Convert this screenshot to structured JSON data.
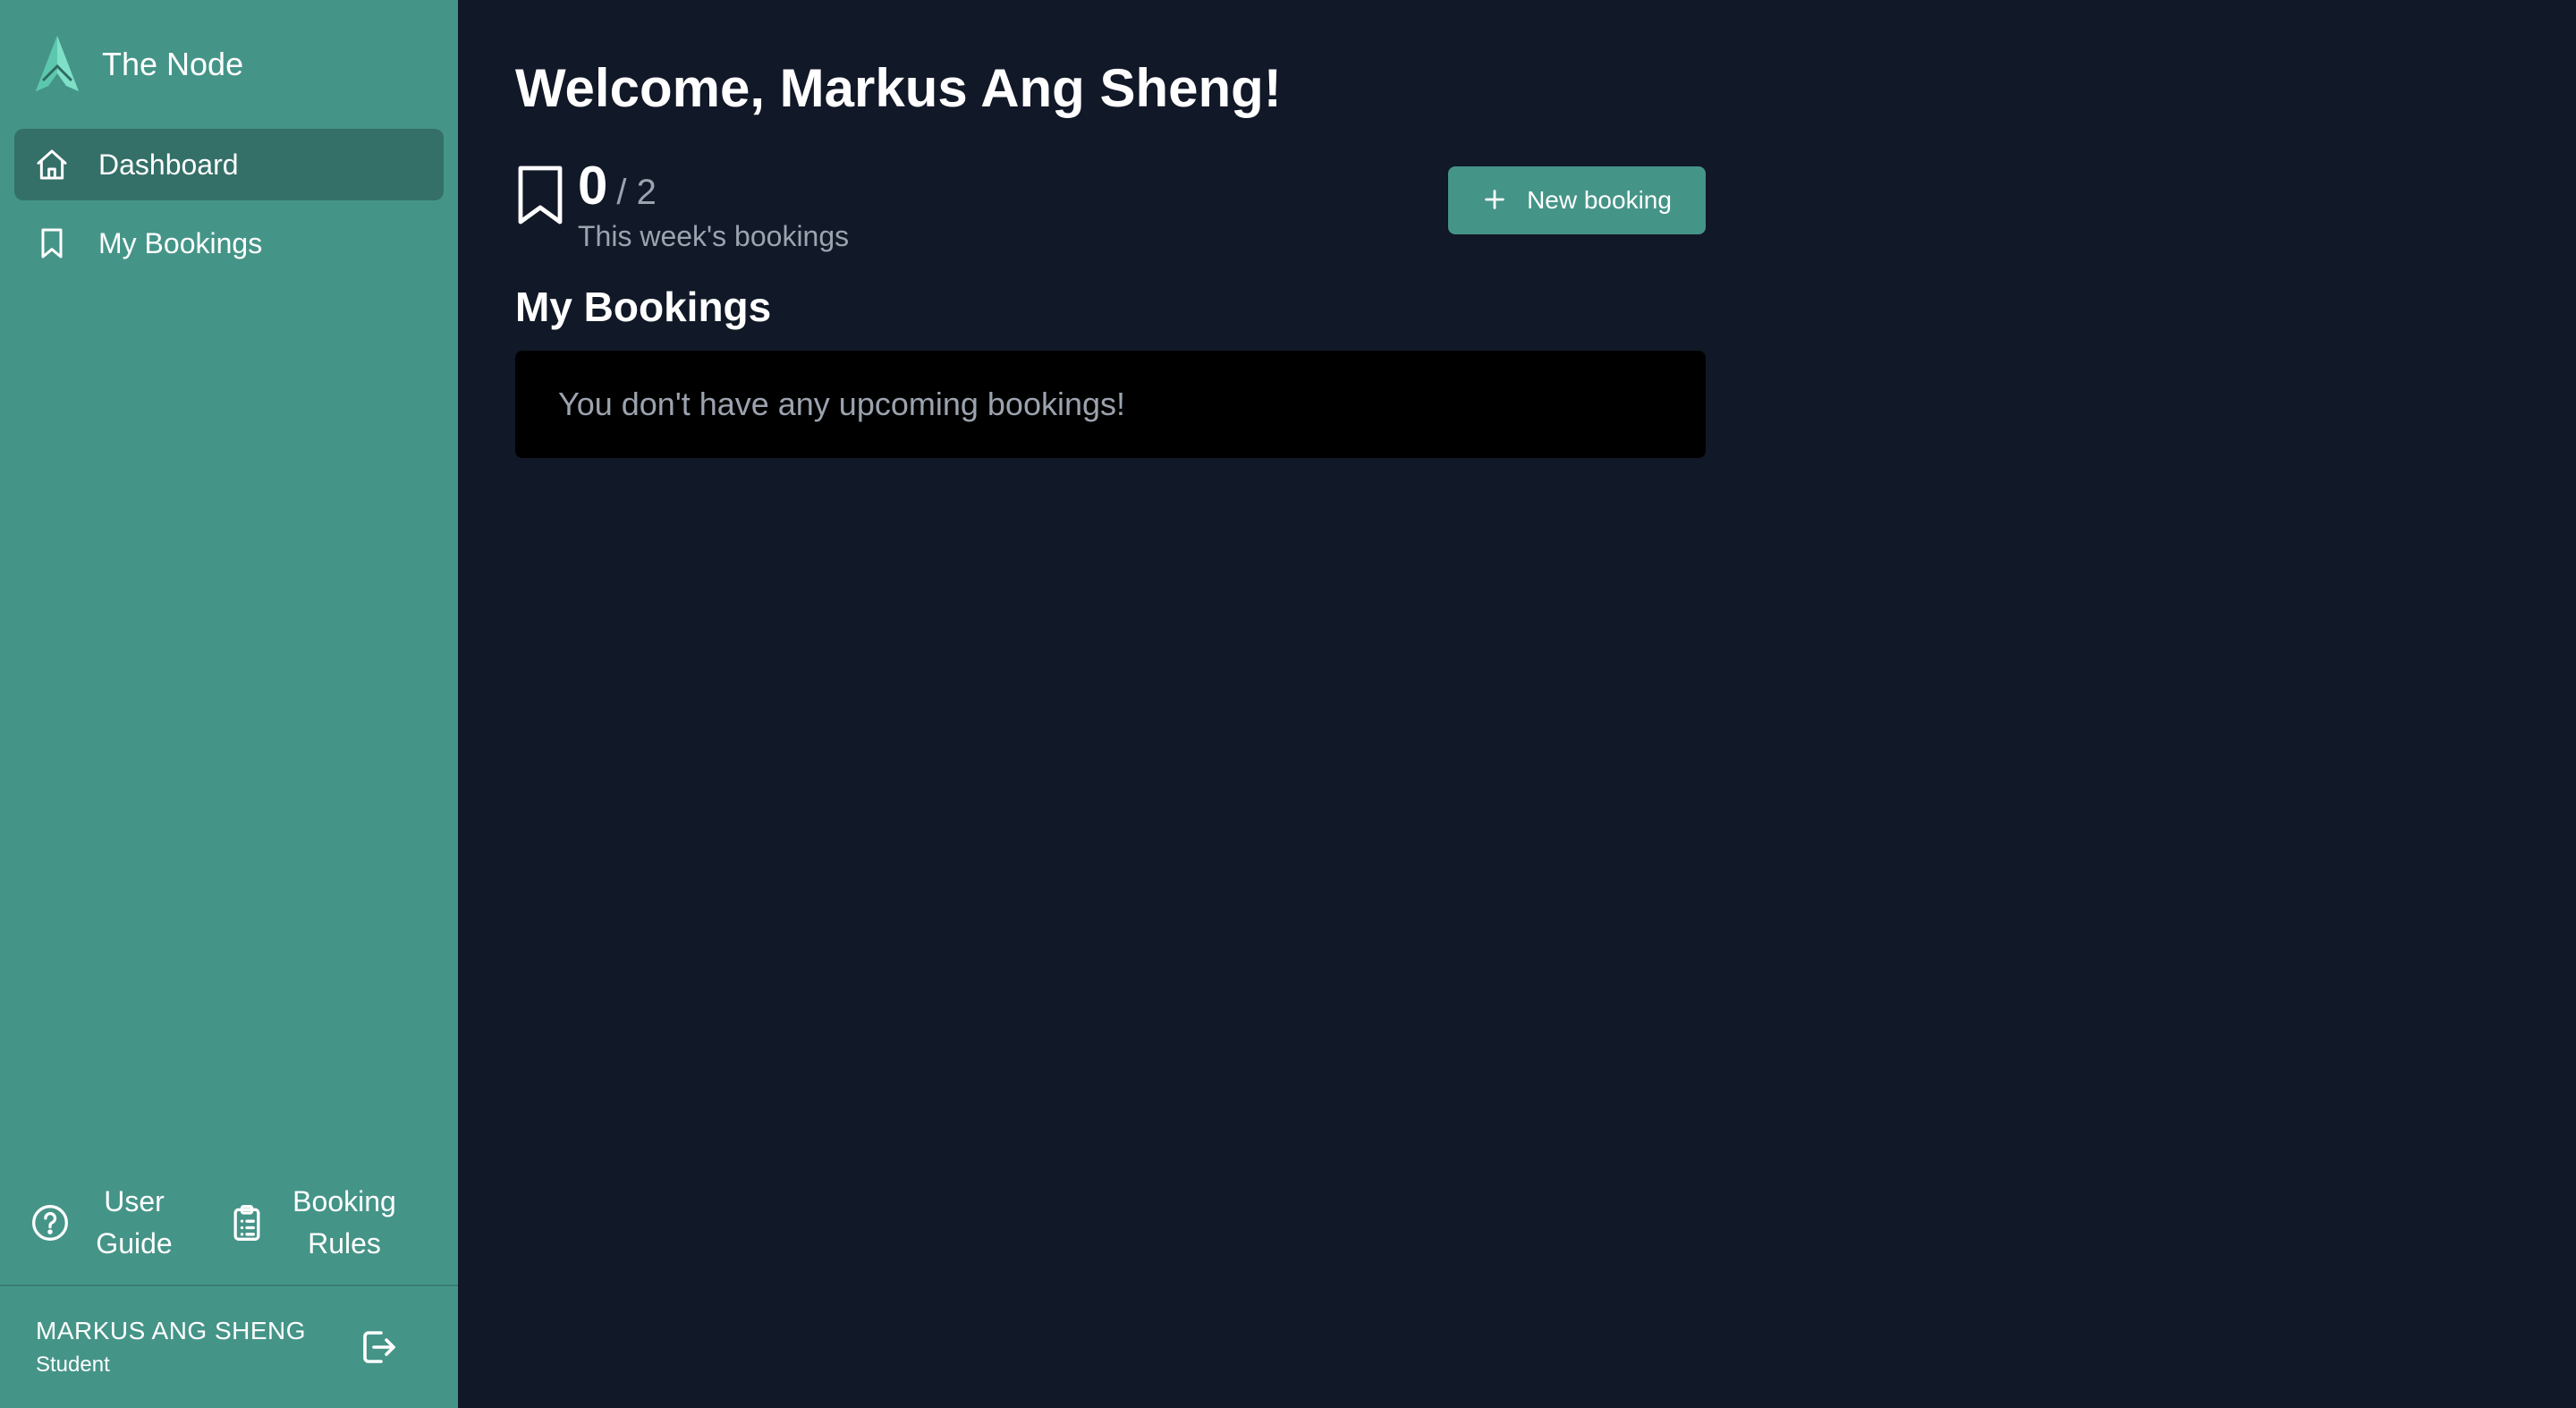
{
  "brand": {
    "name": "The Node",
    "logo": "tent-logo"
  },
  "sidebar": {
    "items": [
      {
        "label": "Dashboard",
        "icon": "home-icon",
        "active": true
      },
      {
        "label": "My Bookings",
        "icon": "bookmark-icon",
        "active": false
      }
    ],
    "bottom_links": [
      {
        "label": "User Guide",
        "icon": "help-circle-icon"
      },
      {
        "label": "Booking Rules",
        "icon": "clipboard-list-icon"
      }
    ],
    "user": {
      "name": "MARKUS ANG SHENG",
      "role": "Student",
      "logout_icon": "logout-icon"
    }
  },
  "main": {
    "welcome": "Welcome, Markus Ang Sheng!",
    "stats": {
      "count": "0",
      "total": "/ 2",
      "label": "This week's bookings"
    },
    "new_booking_label": "New booking",
    "section_title": "My Bookings",
    "empty_message": "You don't have any upcoming bookings!"
  },
  "colors": {
    "sidebar_bg": "#459488",
    "sidebar_active": "#346f68",
    "main_bg": "#111827",
    "accent": "#459488",
    "muted_text": "#9ca3af"
  }
}
